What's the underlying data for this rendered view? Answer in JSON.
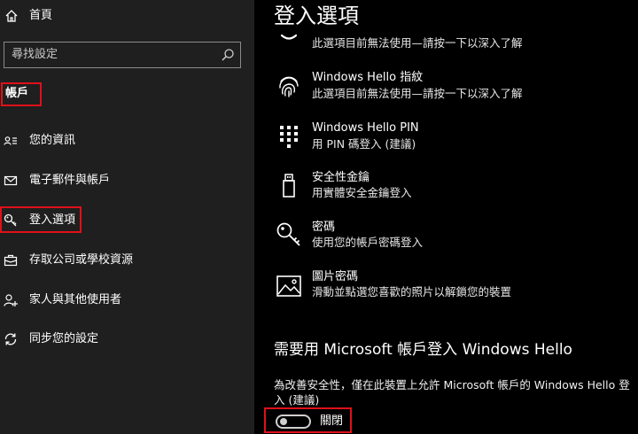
{
  "sidebar": {
    "home_label": "首頁",
    "search_placeholder": "尋找設定",
    "group_title": "帳戶",
    "items": [
      {
        "label": "您的資訊",
        "icon": "person-card-icon"
      },
      {
        "label": "電子郵件與帳戶",
        "icon": "mail-icon"
      },
      {
        "label": "登入選項",
        "icon": "key-icon",
        "selected": true
      },
      {
        "label": "存取公司或學校資源",
        "icon": "briefcase-icon"
      },
      {
        "label": "家人與其他使用者",
        "icon": "add-person-icon"
      },
      {
        "label": "同步您的設定",
        "icon": "sync-icon"
      }
    ]
  },
  "main": {
    "title": "登入選項",
    "options": [
      {
        "title": "",
        "desc": "此選項目前無法使用—請按一下以深入了解",
        "icon": "face-icon"
      },
      {
        "title": "Windows Hello 指紋",
        "desc": "此選項目前無法使用—請按一下以深入了解",
        "icon": "fingerprint-icon"
      },
      {
        "title": "Windows Hello PIN",
        "desc": "用 PIN 碼登入 (建議)",
        "icon": "pin-keypad-icon"
      },
      {
        "title": "安全性金鑰",
        "desc": "用實體安全金鑰登入",
        "icon": "usb-key-icon"
      },
      {
        "title": "密碼",
        "desc": "使用您的帳戶密碼登入",
        "icon": "password-key-icon"
      },
      {
        "title": "圖片密碼",
        "desc": "滑動並點選您喜歡的照片以解鎖您的裝置",
        "icon": "picture-icon"
      }
    ],
    "section": {
      "title": "需要用 Microsoft 帳戶登入 Windows Hello",
      "desc": "為改善安全性，僅在此裝置上允許 Microsoft 帳戶的 Windows Hello 登入 (建議)",
      "toggle_label": "關閉",
      "toggle_on": false
    }
  },
  "colors": {
    "sidebar_bg": "#1f1f1f",
    "main_bg": "#000000",
    "highlight": "#e0101a"
  }
}
